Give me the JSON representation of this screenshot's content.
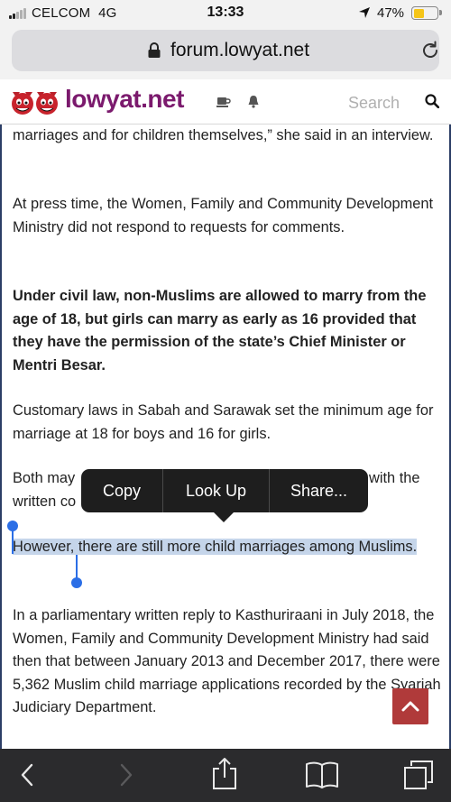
{
  "status_bar": {
    "carrier": "CELCOM",
    "network": "4G",
    "time": "13:33",
    "battery_percent": "47%",
    "battery_level": 0.47,
    "signal_bars": 2,
    "icons": [
      "signal-icon",
      "location-arrow-icon",
      "battery-icon"
    ]
  },
  "browser": {
    "url": "forum.lowyat.net",
    "icons": [
      "lock-icon",
      "reload-icon"
    ]
  },
  "site_header": {
    "logo_text": "lowyat.net",
    "search_placeholder": "Search",
    "brand_color": "#7b1a6d",
    "icons": [
      "logo-devils-icon",
      "coffee-cup-icon",
      "bell-icon",
      "search-icon"
    ]
  },
  "article": {
    "paragraphs": [
      {
        "text": "marriages and for children themselves,” she said in an interview.",
        "bold": false
      },
      {
        "text": "At press time, the Women, Family and Community Development Ministry did not respond to requests for comments.",
        "bold": false
      },
      {
        "text": "Under civil law, non-Muslims are allowed to marry from the age of 18, but girls can marry as early as 16 provided that they have the permission of the state’s Chief Minister or Mentri Besar.",
        "bold": true
      },
      {
        "text": "Customary laws in Sabah and Sarawak set the minimum age for marriage at 18 for boys and 16 for girls.",
        "bold": false
      },
      {
        "text_left": "Both may",
        "text_right": "with the",
        "text_line2": "written co",
        "bold": false
      },
      {
        "text": "However, there are still more child marriages among Muslims.",
        "bold": false,
        "selected": true
      },
      {
        "text": "In a parliamentary written reply to Kasthuriraani in July 2018, the Women, Family and Community Development Ministry had said then that between January 2013 and December 2017, there were 5,362 Muslim child marriage applications recorded by the Syariah Judiciary Department.",
        "bold": false
      }
    ]
  },
  "context_menu": {
    "items": [
      {
        "label": "Copy"
      },
      {
        "label": "Look Up"
      },
      {
        "label": "Share..."
      }
    ]
  },
  "scroll_top_button": {
    "icon": "chevron-up-icon",
    "color": "#b03a3a"
  },
  "toolbar": {
    "icons": [
      "back-icon",
      "forward-icon",
      "share-icon",
      "bookmarks-icon",
      "tabs-icon"
    ]
  }
}
